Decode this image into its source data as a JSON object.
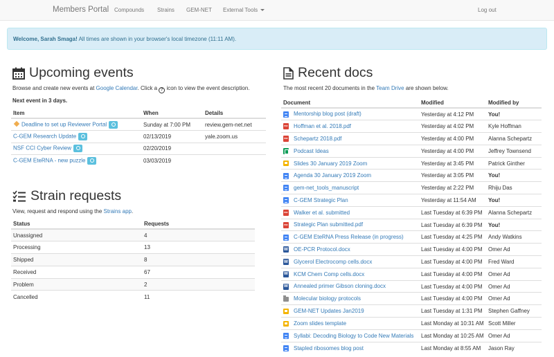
{
  "navbar": {
    "brand": "Members Portal",
    "links": [
      "Compounds",
      "Strains",
      "GEM-NET"
    ],
    "dropdown": "External Tools",
    "logout": "Log out"
  },
  "alert": {
    "welcome": "Welcome, Sarah Smaga!",
    "message": " All times are shown in your browser's local timezone (11:11 AM)."
  },
  "events": {
    "title": "Upcoming events",
    "intro_before": "Browse and create new events at ",
    "intro_link": "Google Calendar",
    "intro_mid": ". Click a ",
    "intro_icon": "?",
    "intro_after": " icon to view the event description.",
    "next_event": "Next event in 3 days.",
    "columns": [
      "Item",
      "When",
      "Details"
    ],
    "rows": [
      {
        "item": "Deadline to set up Reviewer Portal",
        "when": "Sunday at 7:00 PM",
        "details": "review.gem-net.net",
        "highlight": true
      },
      {
        "item": "C-GEM Research Update",
        "when": "02/13/2019",
        "details": "yale.zoom.us",
        "highlight": false
      },
      {
        "item": "NSF CCI Cyber Review",
        "when": "02/20/2019",
        "details": "",
        "highlight": false
      },
      {
        "item": "C-GEM EteRNA - new puzzle",
        "when": "03/03/2019",
        "details": "",
        "highlight": false
      }
    ]
  },
  "strains": {
    "title": "Strain requests",
    "intro_before": "View, request and respond using the ",
    "intro_link": "Strains app",
    "intro_after": ".",
    "columns": [
      "Status",
      "Requests"
    ],
    "rows": [
      {
        "status": "Unassigned",
        "requests": "4"
      },
      {
        "status": "Processing",
        "requests": "13"
      },
      {
        "status": "Shipped",
        "requests": "8"
      },
      {
        "status": "Received",
        "requests": "67"
      },
      {
        "status": "Problem",
        "requests": "2"
      },
      {
        "status": "Cancelled",
        "requests": "11"
      }
    ]
  },
  "docs": {
    "title": "Recent docs",
    "intro_before": "The most recent 20 documents in the ",
    "intro_link": "Team Drive",
    "intro_after": " are shown below.",
    "columns": [
      "Document",
      "Modified",
      "Modified by"
    ],
    "rows": [
      {
        "icon": "gdoc",
        "name": "Mentorship blog post (draft)",
        "modified": "Yesterday at 4:12 PM",
        "by": "You!"
      },
      {
        "icon": "pdf",
        "name": "Hoffman et al. 2018.pdf",
        "modified": "Yesterday at 4:02 PM",
        "by": "Kyle Hoffman"
      },
      {
        "icon": "pdf",
        "name": "Schepartz 2018.pdf",
        "modified": "Yesterday at 4:00 PM",
        "by": "Alanna Schepartz"
      },
      {
        "icon": "sheet",
        "name": "Podcast Ideas",
        "modified": "Yesterday at 4:00 PM",
        "by": "Jeffrey Townsend"
      },
      {
        "icon": "slides",
        "name": "Slides 30 January 2019 Zoom",
        "modified": "Yesterday at 3:45 PM",
        "by": "Patrick Ginther"
      },
      {
        "icon": "gdoc",
        "name": "Agenda 30 January 2019 Zoom",
        "modified": "Yesterday at 3:05 PM",
        "by": "You!"
      },
      {
        "icon": "gdoc",
        "name": "gem-net_tools_manuscript",
        "modified": "Yesterday at 2:22 PM",
        "by": "Rhiju Das"
      },
      {
        "icon": "gdoc",
        "name": "C-GEM Strategic Plan",
        "modified": "Yesterday at 11:54 AM",
        "by": "You!"
      },
      {
        "icon": "pdf",
        "name": "Walker et al. submitted",
        "modified": "Last Tuesday at 6:39 PM",
        "by": "Alanna Schepartz"
      },
      {
        "icon": "pdf",
        "name": "Strategic Plan submitted.pdf",
        "modified": "Last Tuesday at 6:39 PM",
        "by": "You!"
      },
      {
        "icon": "gdoc",
        "name": "C-GEM EteRNA Press Release (in progress)",
        "modified": "Last Tuesday at 4:25 PM",
        "by": "Andy Watkins"
      },
      {
        "icon": "word",
        "name": "OE-PCR Protocol.docx",
        "modified": "Last Tuesday at 4:00 PM",
        "by": "Omer Ad"
      },
      {
        "icon": "word",
        "name": "Glycerol Electrocomp cells.docx",
        "modified": "Last Tuesday at 4:00 PM",
        "by": "Fred Ward"
      },
      {
        "icon": "word",
        "name": "KCM Chem Comp cells.docx",
        "modified": "Last Tuesday at 4:00 PM",
        "by": "Omer Ad"
      },
      {
        "icon": "word",
        "name": "Annealed primer Gibson cloning.docx",
        "modified": "Last Tuesday at 4:00 PM",
        "by": "Omer Ad"
      },
      {
        "icon": "folder",
        "name": "Molecular biology protocols",
        "modified": "Last Tuesday at 4:00 PM",
        "by": "Omer Ad"
      },
      {
        "icon": "slides",
        "name": "GEM-NET Updates Jan2019",
        "modified": "Last Tuesday at 1:31 PM",
        "by": "Stephen Gaffney"
      },
      {
        "icon": "slides",
        "name": "Zoom slides template",
        "modified": "Last Monday at 10:31 AM",
        "by": "Scott Miller"
      },
      {
        "icon": "gdoc",
        "name": "Syllabi: Decoding Biology to Code New Materials",
        "modified": "Last Monday at 10:25 AM",
        "by": "Omer Ad"
      },
      {
        "icon": "gdoc",
        "name": "Stapled ribosomes blog post",
        "modified": "Last Monday at 8:55 AM",
        "by": "Jason Ray"
      }
    ]
  }
}
